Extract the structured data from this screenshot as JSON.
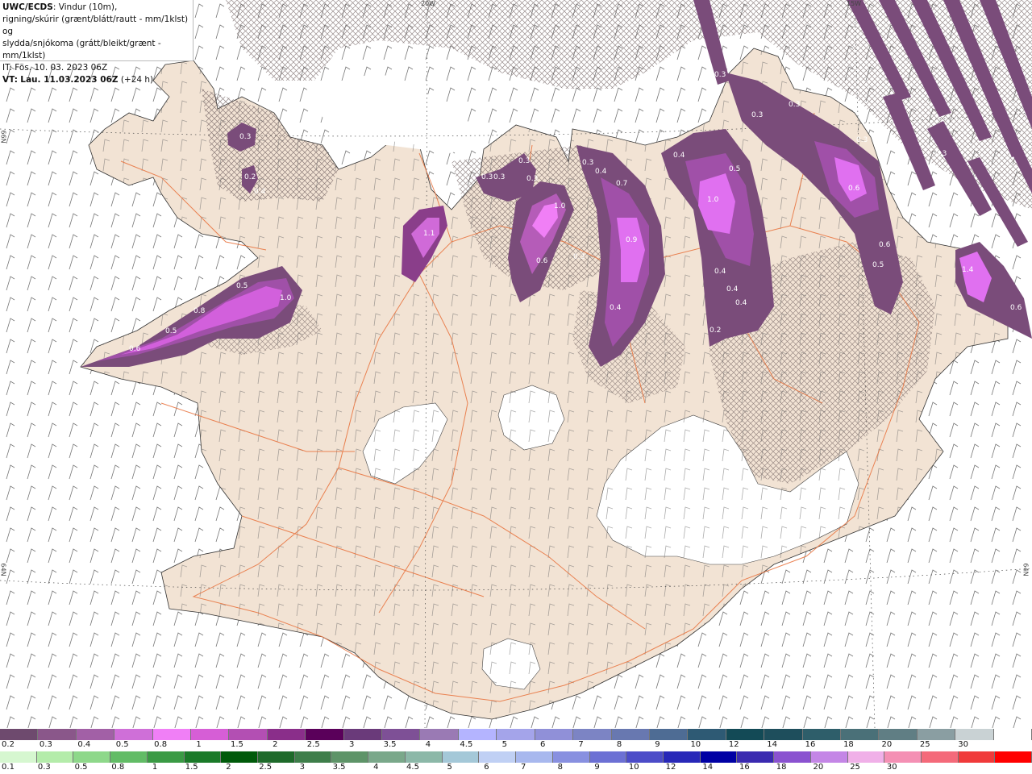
{
  "info": {
    "model": "UWC/ECDS",
    "description_1": ": Vindur (10m),",
    "description_2": "rigning/skúrir (grænt/blátt/rautt - mm/1klst) og",
    "description_3": "slydda/snjókoma (grátt/bleikt/grænt - mm/1klst)",
    "init_time": "IT: Fös. 10. 03. 2023 06Z",
    "valid_label": "VT:",
    "valid_time": "Lau. 11.03.2023 06Z",
    "lead": "(+24 h)"
  },
  "grid_labels": {
    "lon_20w": "20W",
    "lon_15w": "15W",
    "lat_66n": "66N",
    "lat_64n_left": "64N",
    "lat_64n_right": "64N"
  },
  "precip_labels": [
    "0.3",
    "0.2",
    "0.4",
    "1.1",
    "0.3",
    "0.3",
    "0.3",
    "0.3",
    "1.0",
    "0.6",
    "0.3",
    "0.3",
    "0.4",
    "0.7",
    "0.9",
    "0.4",
    "0.4",
    "1.0",
    "0.5",
    "0.4",
    "0.4",
    "0.4",
    "0.2",
    "0.3",
    "0.3",
    "0.3",
    "0.6",
    "0.6",
    "0.5",
    "0.3",
    "1.4",
    "0.6",
    "0.5",
    "0.8",
    "0.6",
    "1.0",
    "0.3",
    "0.5"
  ],
  "legend": {
    "snow_colors": [
      "#6e4a6e",
      "#8a578a",
      "#a260a6",
      "#cf6fd8",
      "#f07ff6",
      "#d65ed6",
      "#b34fb3",
      "#8a2e8a",
      "#5a005a",
      "#6a3a7a",
      "#7e5096",
      "#9a7ab4",
      "#b4b4ff",
      "#a4a4ea",
      "#9090d8",
      "#7c84c4",
      "#6878b0",
      "#4e6c94",
      "#2e5a74",
      "#134a56",
      "#1e4e5c",
      "#2e5e6a",
      "#4a7078",
      "#607e84",
      "#8a9ea2",
      "#c9d2d4",
      "#ffffff"
    ],
    "snow_labels": [
      "0.2",
      "0.3",
      "0.4",
      "0.5",
      "0.8",
      "1",
      "1.5",
      "2",
      "2.5",
      "3",
      "3.5",
      "4",
      "4.5",
      "5",
      "6",
      "7",
      "8",
      "9",
      "10",
      "12",
      "14",
      "16",
      "18",
      "20",
      "25",
      "30"
    ],
    "rain_colors": [
      "#d6f7d0",
      "#b4ecaa",
      "#8ed88a",
      "#62bc66",
      "#3a9a44",
      "#1a7a28",
      "#005a0a",
      "#1e6a2a",
      "#3e7e4a",
      "#5e9468",
      "#7aa88a",
      "#8cb8a8",
      "#a4c8d8",
      "#c0d0f4",
      "#a8b8ee",
      "#8890e0",
      "#6c70d4",
      "#4c4cc8",
      "#2828b8",
      "#0000a4",
      "#3a2ab0",
      "#8a52d0",
      "#c486e6",
      "#f0b0e8",
      "#f490b4",
      "#f46a7a",
      "#f03a3a",
      "#ff0000"
    ],
    "rain_labels": [
      "0.1",
      "0.3",
      "0.5",
      "0.8",
      "1",
      "1.5",
      "2",
      "2.5",
      "3",
      "3.5",
      "4",
      "4.5",
      "5",
      "6",
      "7",
      "8",
      "9",
      "10",
      "12",
      "14",
      "16",
      "18",
      "20",
      "25",
      "30"
    ]
  },
  "colors": {
    "land": "#f2e3d4",
    "ocean": "#ffffff",
    "glacier": "#ffffff",
    "roads": "#e8703a",
    "snow_light": "#7a4c7a",
    "snow_mid": "#a050a8",
    "snow_heavy": "#e070f0"
  }
}
